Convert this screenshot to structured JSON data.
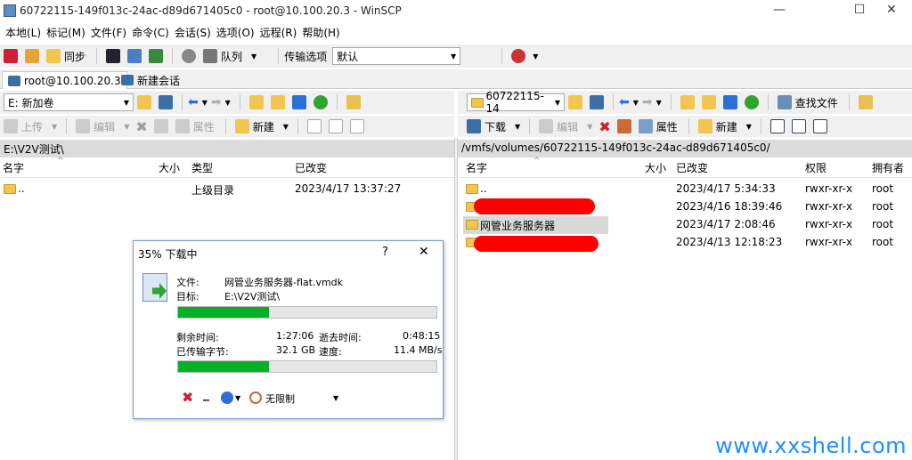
{
  "window": {
    "title": "60722115-149f013c-24ac-d89d671405c0 - root@10.100.20.3 - WinSCP",
    "minimize": "—",
    "maximize": "☐",
    "close": "✕"
  },
  "menu": [
    "本地(L)",
    "标记(M)",
    "文件(F)",
    "命令(C)",
    "会话(S)",
    "选项(O)",
    "远程(R)",
    "帮助(H)"
  ],
  "toolbar_main": {
    "sync_label": "同步",
    "queue_label": "队列",
    "transfer_options_label": "传输选项",
    "transfer_preset": "默认"
  },
  "tabs": {
    "session": "root@10.100.20.3",
    "new_session": "新建会话"
  },
  "local": {
    "drive": "E: 新加卷",
    "path": "E:\\V2V测试\\",
    "upload_label": "上传",
    "edit_label": "编辑",
    "properties_label": "属性",
    "new_label": "新建",
    "columns": [
      "名字",
      "大小",
      "类型",
      "已改变"
    ],
    "rows": [
      {
        "name": "..",
        "size": "",
        "type": "上级目录",
        "changed": "2023/4/17   13:37:27"
      }
    ]
  },
  "remote": {
    "dir": "60722115-14",
    "path": "/vmfs/volumes/60722115-149f013c-24ac-d89d671405c0/",
    "download_label": "下载",
    "edit_label": "编辑",
    "properties_label": "属性",
    "new_label": "新建",
    "find_label": "查找文件",
    "columns": [
      "名字",
      "大小",
      "已改变",
      "权限",
      "拥有者"
    ],
    "rows": [
      {
        "name": "..",
        "changed": "2023/4/17 5:34:33",
        "rights": "rwxr-xr-x",
        "owner": "root"
      },
      {
        "name": "",
        "changed": "2023/4/16 18:39:46",
        "rights": "rwxr-xr-x",
        "owner": "root"
      },
      {
        "name": "网管业务服务器",
        "changed": "2023/4/17 2:08:46",
        "rights": "rwxr-xr-x",
        "owner": "root"
      },
      {
        "name": "",
        "changed": "2023/4/13 12:18:23",
        "rights": "rwxr-xr-x",
        "owner": "root"
      }
    ]
  },
  "dialog": {
    "title": "35% 下载中",
    "help": "?",
    "close": "✕",
    "file_label": "文件:",
    "file_value": "网管业务服务器-flat.vmdk",
    "target_label": "目标:",
    "target_value": "E:\\V2V测试\\",
    "progress_file": 0.35,
    "time_left_label": "剩余时间:",
    "time_left_value": "1:27:06",
    "elapsed_label": "逝去时间:",
    "elapsed_value": "0:48:15",
    "bytes_label": "已传输字节:",
    "bytes_value": "32.1 GB",
    "speed_label": "速度:",
    "speed_value": "11.4 MB/s",
    "progress_total": 0.35,
    "cancel_icon": "✖",
    "minimize_icon": "_",
    "speed_limit": "无限制"
  },
  "watermark": "www.xxshell.com"
}
